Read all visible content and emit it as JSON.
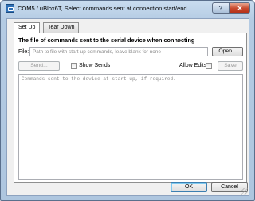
{
  "window": {
    "title": "COM5 / uBlox6T,  Select commands sent at connection start/end",
    "help_label": "?",
    "close_label": "✕"
  },
  "tabs": [
    {
      "label": "Set Up",
      "active": true
    },
    {
      "label": "Tear Down",
      "active": false
    }
  ],
  "setup": {
    "heading": "The file of commands sent to the serial device when connecting",
    "file_label": "File:",
    "file_value": "",
    "file_placeholder": "Path to file with start-up commands, leave blank for none",
    "open_label": "Open...",
    "send_label": "Send...",
    "send_enabled": false,
    "show_sends_label": "Show Sends",
    "show_sends_checked": false,
    "allow_edits_label": "Allow Edits",
    "allow_edits_checked": false,
    "save_label": "Save",
    "save_enabled": false,
    "commands_value": "",
    "commands_placeholder": "Commands sent to the device at start-up, if required."
  },
  "footer": {
    "ok_label": "OK",
    "cancel_label": "Cancel"
  }
}
